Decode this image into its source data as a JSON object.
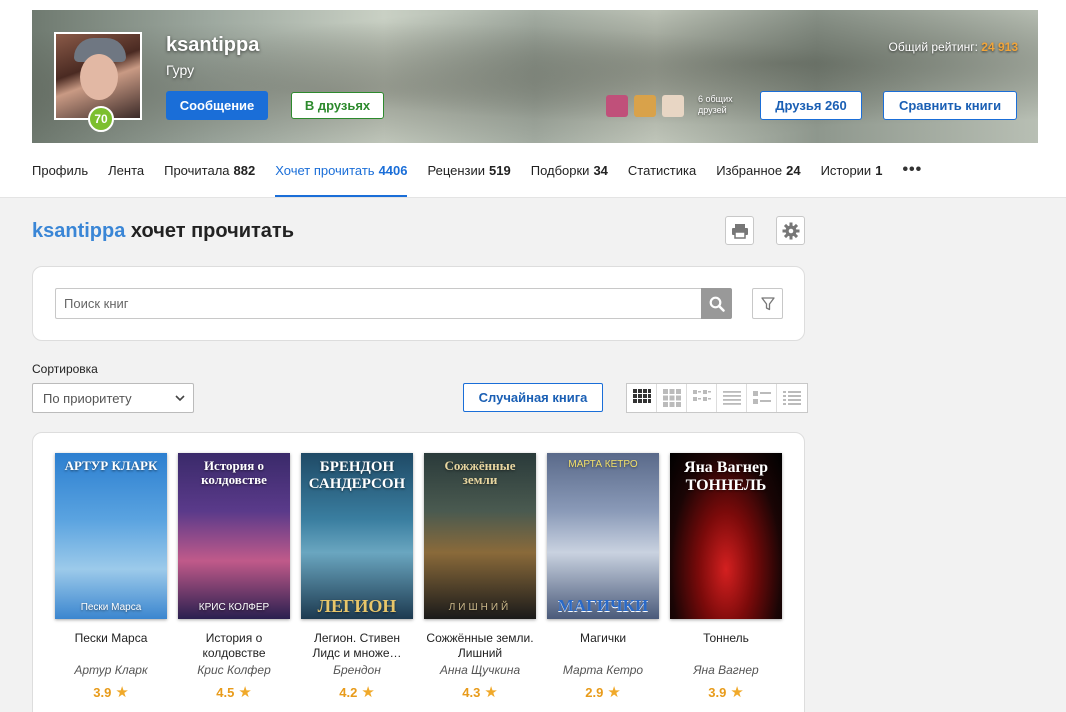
{
  "profile": {
    "username": "ksantippa",
    "rank": "Гуру",
    "level": "70",
    "message_label": "Сообщение",
    "friend_status_label": "В друзьях",
    "rating_label": "Общий рейтинг:",
    "rating_value": "24 913",
    "mutual_text": "6 общих друзей",
    "friends_label": "Друзья 260",
    "compare_label": "Сравнить книги"
  },
  "tabs": [
    {
      "label": "Профиль",
      "count": ""
    },
    {
      "label": "Лента",
      "count": ""
    },
    {
      "label": "Прочитала",
      "count": "882"
    },
    {
      "label": "Хочет прочитать",
      "count": "4406"
    },
    {
      "label": "Рецензии",
      "count": "519"
    },
    {
      "label": "Подборки",
      "count": "34"
    },
    {
      "label": "Статистика",
      "count": ""
    },
    {
      "label": "Избранное",
      "count": "24"
    },
    {
      "label": "Истории",
      "count": "1"
    }
  ],
  "more_label": "•••",
  "page": {
    "title_user": "ksantippa",
    "title_rest": " хочет прочитать"
  },
  "search": {
    "placeholder": "Поиск книг"
  },
  "sort": {
    "label": "Сортировка",
    "selected": "По приоритету"
  },
  "random_label": "Случайная книга",
  "books": [
    {
      "title": "Пески Марса",
      "author": "Артур Кларк",
      "rating": "3.9",
      "cover_top": "АРТУР КЛАРК",
      "cover_bottom": "Пески Марса"
    },
    {
      "title": "История о колдовстве",
      "author": "Крис Колфер",
      "rating": "4.5",
      "cover_top": "История о колдовстве",
      "cover_bottom": "КРИС КОЛФЕР"
    },
    {
      "title": "Легион. Стивен Лидс и множе…",
      "author": "Брендон",
      "rating": "4.2",
      "cover_top": "БРЕНДОН САНДЕРСОН",
      "cover_bottom": "ЛЕГИОН"
    },
    {
      "title": "Сожжённые земли. Лишний",
      "author": "Анна Щучкина",
      "rating": "4.3",
      "cover_top": "Сожжённые земли",
      "cover_bottom": "ЛИШНИЙ"
    },
    {
      "title": "Магички",
      "author": "Марта Кетро",
      "rating": "2.9",
      "cover_top": "МАРТА КЕТРО",
      "cover_bottom": "МАГИЧКИ"
    },
    {
      "title": "Тоннель",
      "author": "Яна Вагнер",
      "rating": "3.9",
      "cover_top": "Яна Вагнер ТОННЕЛЬ",
      "cover_bottom": ""
    }
  ]
}
